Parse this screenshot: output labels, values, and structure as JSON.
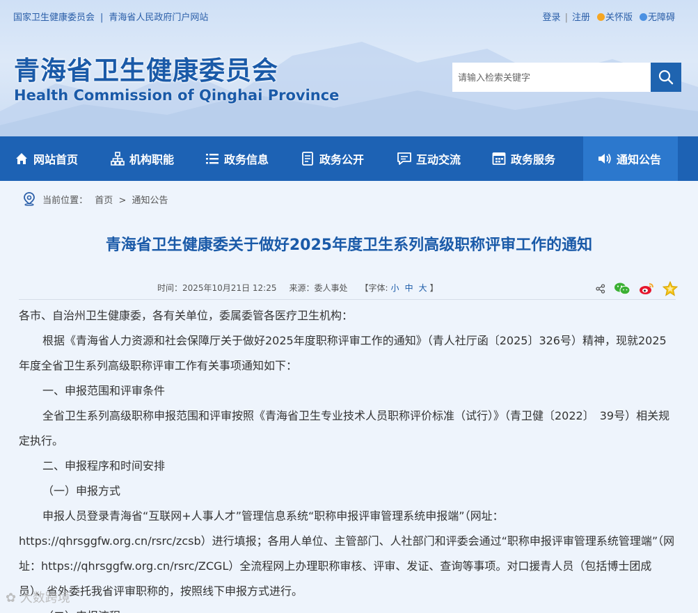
{
  "topbar": {
    "left_link_1": "国家卫生健康委员会",
    "separator": "|",
    "left_link_2": "青海省人民政府门户网站",
    "login": "登录",
    "register": "注册",
    "care_mode": "关怀版",
    "accessibility": "无障碍"
  },
  "brand": {
    "name_cn": "青海省卫生健康委员会",
    "name_en": "Health Commission of Qinghai Province"
  },
  "search": {
    "placeholder": "请输入检索关键字",
    "icon": "search-icon"
  },
  "nav": {
    "items": [
      {
        "label": "网站首页",
        "icon": "home-icon"
      },
      {
        "label": "机构职能",
        "icon": "org-chart-icon"
      },
      {
        "label": "政务信息",
        "icon": "list-icon"
      },
      {
        "label": "政务公开",
        "icon": "document-icon"
      },
      {
        "label": "互动交流",
        "icon": "chat-icon"
      },
      {
        "label": "政务服务",
        "icon": "service-icon"
      },
      {
        "label": "通知公告",
        "icon": "speaker-icon",
        "active": true
      }
    ],
    "active_color": "#2c78cd",
    "bar_color": "#1d62b4"
  },
  "breadcrumb": {
    "prefix": "当前位置：",
    "home": "首页",
    "arrow": ">",
    "current": "通知公告"
  },
  "article": {
    "title": "青海省卫生健康委关于做好2025年度卫生系列高级职称评审工作的通知",
    "meta_time": "时间：2025年10月21日 12:25",
    "meta_source": "来源：委人事处",
    "font_label_open": "【字体:",
    "font_small": "小",
    "font_medium": "中",
    "font_large": "大",
    "font_label_close": "】",
    "share_icons": [
      "share-icon",
      "wechat-icon",
      "weibo-icon",
      "favorite-icon"
    ],
    "paragraphs": [
      "各市、自治州卫生健康委，各有关单位，委属委管各医疗卫生机构：",
      "根据《青海省人力资源和社会保障厅关于做好2025年度职称评审工作的通知》（青人社厅函〔2025〕326号）精神，现就2025年度全省卫生系列高级职称评审工作有关事项通知如下：",
      "一、申报范围和评审条件",
      "全省卫生系列高级职称申报范围和评审按照《青海省卫生专业技术人员职称评价标准（试行）》（青卫健〔2022〕　39号）相关规定执行。",
      "二、申报程序和时间安排",
      "（一）申报方式",
      "申报人员登录青海省“互联网+人事人才”管理信息系统“职称申报评审管理系统申报端”（网址：https://qhrsggfw.org.cn/rsrc/zcsb）进行填报；各用人单位、主管部门、人社部门和评委会通过“职称申报评审管理系统管理端”（网址：https://qhrsggfw.org.cn/rsrc/ZCGL）全流程网上办理职称审核、评审、发证、查询等事项。对口援青人员（包括博士团成员）、省外委托我省评审职称的，按照线下申报方式进行。",
      "（二）申报流程"
    ]
  },
  "watermark": "大数跨境",
  "colors": {
    "primary_blue": "#1a5aa8",
    "link_blue": "#2a5ea8"
  }
}
